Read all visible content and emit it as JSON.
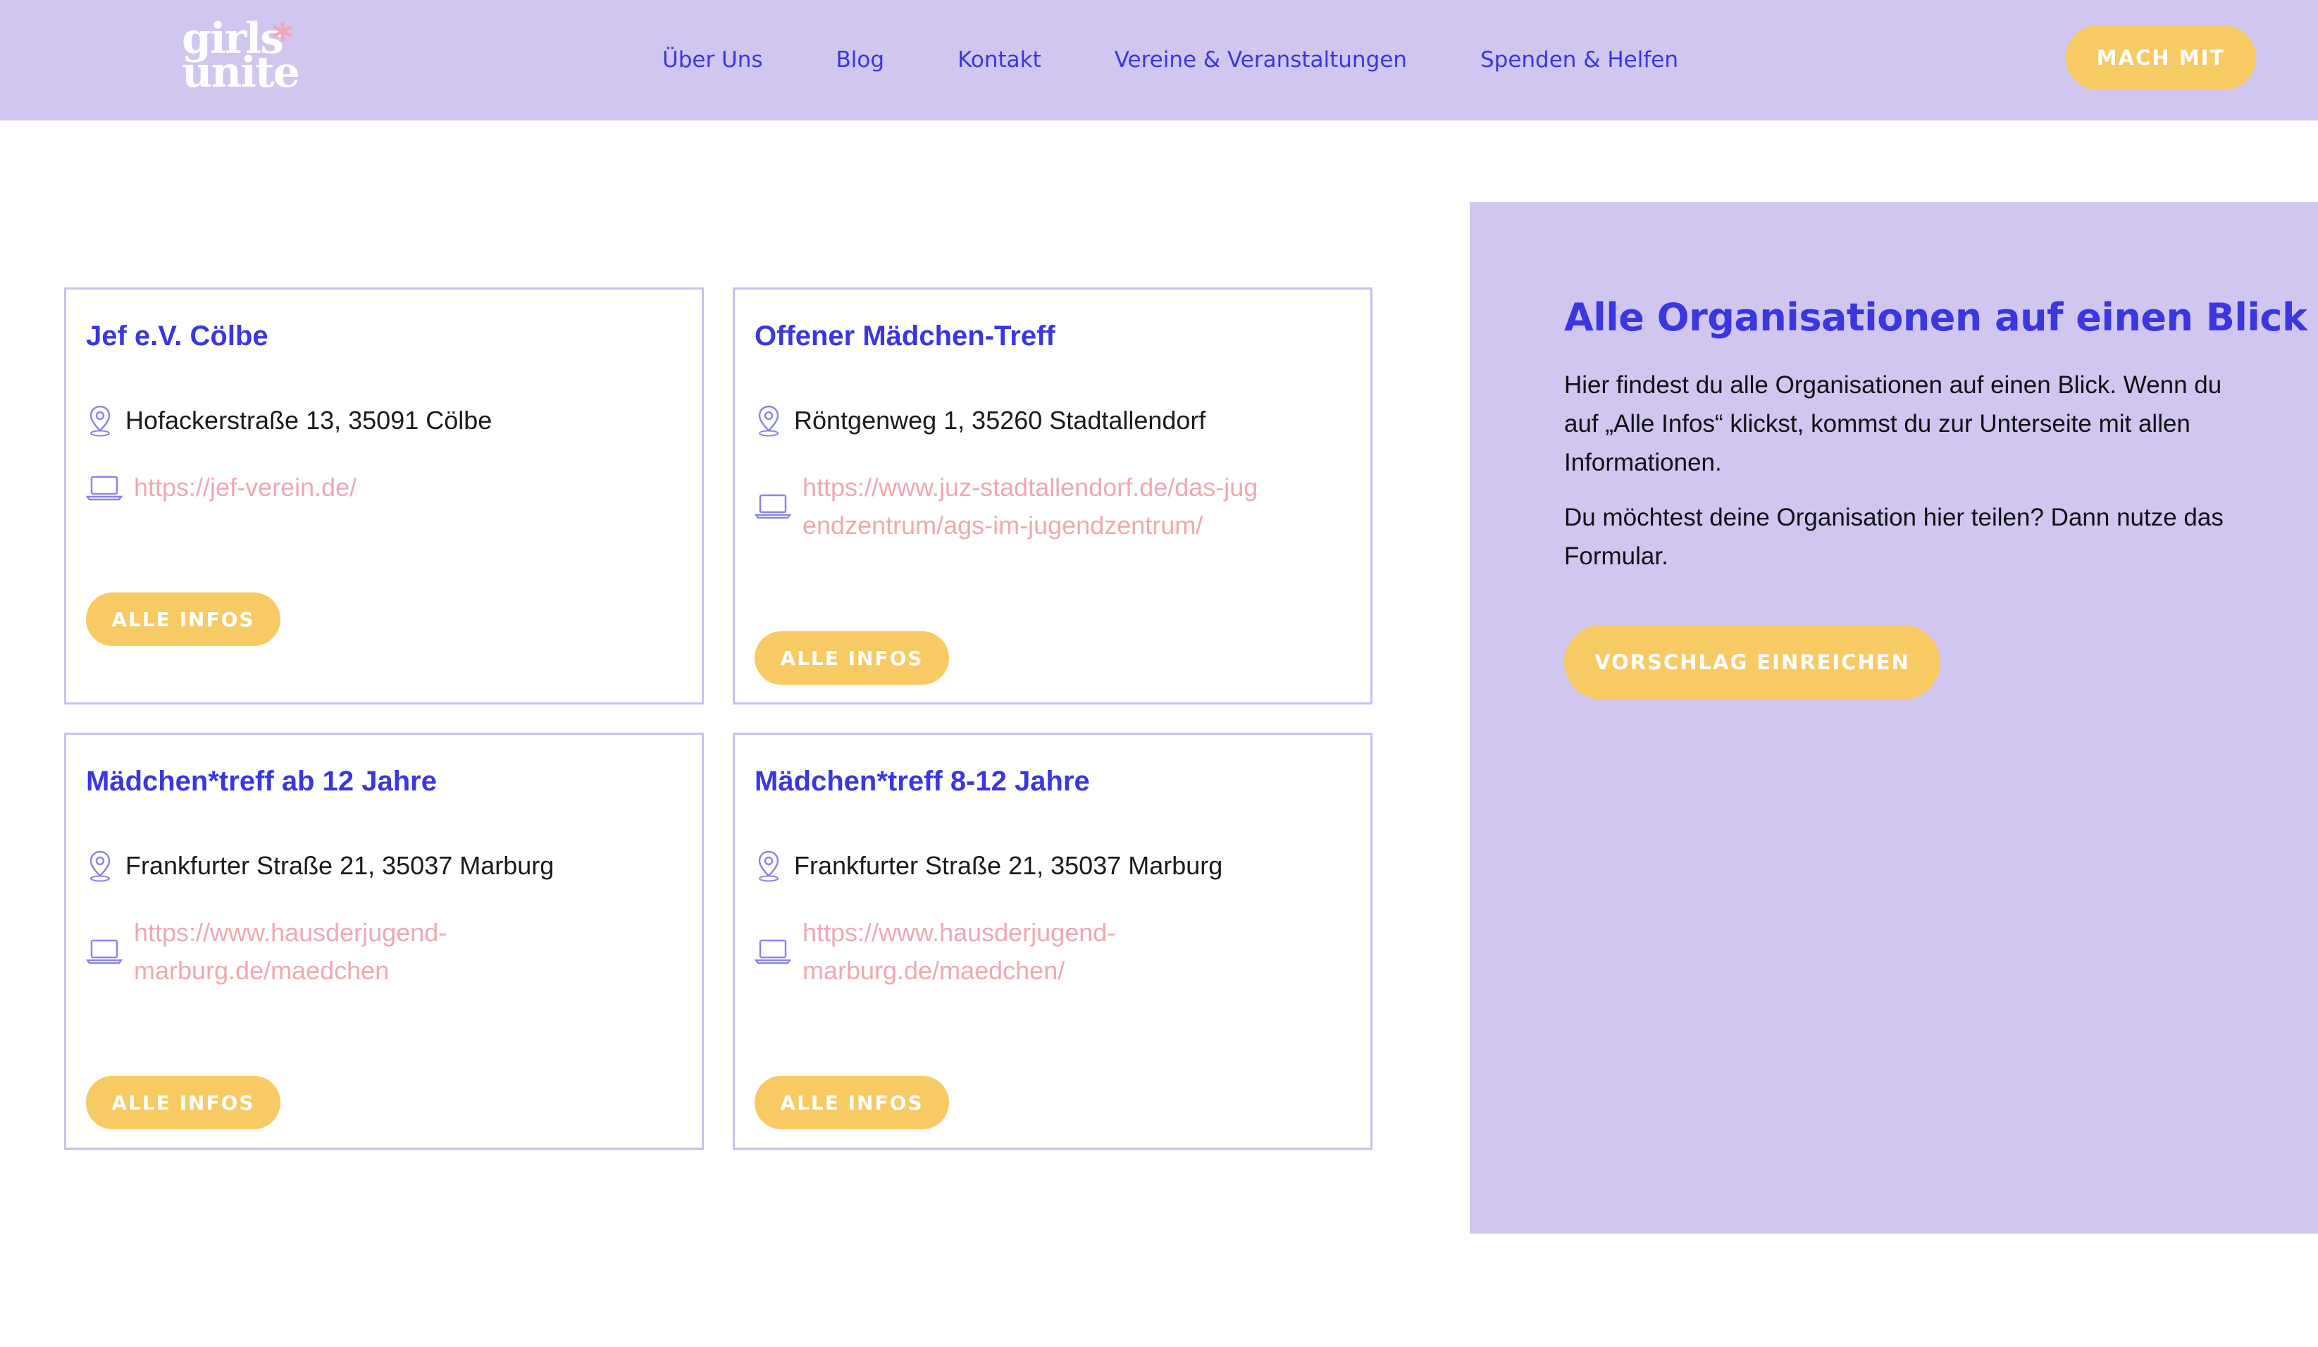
{
  "header": {
    "logo_line1": "girls",
    "logo_line2": "unite",
    "logo_star": "*",
    "nav": [
      {
        "label": "Über Uns"
      },
      {
        "label": "Blog"
      },
      {
        "label": "Kontakt"
      },
      {
        "label": "Vereine & Veranstaltungen"
      },
      {
        "label": "Spenden & Helfen"
      }
    ],
    "cta_label": "MACH MIT"
  },
  "cards": [
    {
      "title": "Jef e.V. Cölbe",
      "address": "Hofackerstraße 13, 35091 Cölbe",
      "website": "https://jef-verein.de/",
      "button": "ALLE INFOS"
    },
    {
      "title": "Offener Mädchen-Treff",
      "address": "Röntgenweg 1, 35260 Stadtallendorf",
      "website": "https://www.juz-stadtallendorf.de/das-jugendzentrum/ags-im-jugendzentrum/",
      "button": "ALLE INFOS"
    },
    {
      "title": "Mädchen*treff ab 12 Jahre",
      "address": "Frankfurter Straße 21, 35037 Marburg",
      "website": "https://www.hausderjugend-marburg.de/maedchen",
      "button": "ALLE INFOS"
    },
    {
      "title": "Mädchen*treff 8-12 Jahre",
      "address": "Frankfurter Straße 21, 35037 Marburg",
      "website": "https://www.hausderjugend-marburg.de/maedchen/",
      "button": "ALLE INFOS"
    }
  ],
  "side_panel": {
    "title": "Alle Organisationen auf einen Blick",
    "paragraph1": "Hier findest du alle Organisationen auf einen Blick. Wenn du auf „Alle Infos“ klickst, kommst du zur Unterseite mit allen Informationen.",
    "paragraph2": "Du möchtest deine Organisation hier teilen? Dann nutze das Formular.",
    "button": "VORSCHLAG EINREICHEN"
  },
  "colors": {
    "lavender": "#d0c6f0",
    "brand_blue": "#3a36e0",
    "button_yellow": "#f7ca63",
    "link_pink": "#f0a9ae",
    "logo_star_pink": "#f2a7b4"
  }
}
